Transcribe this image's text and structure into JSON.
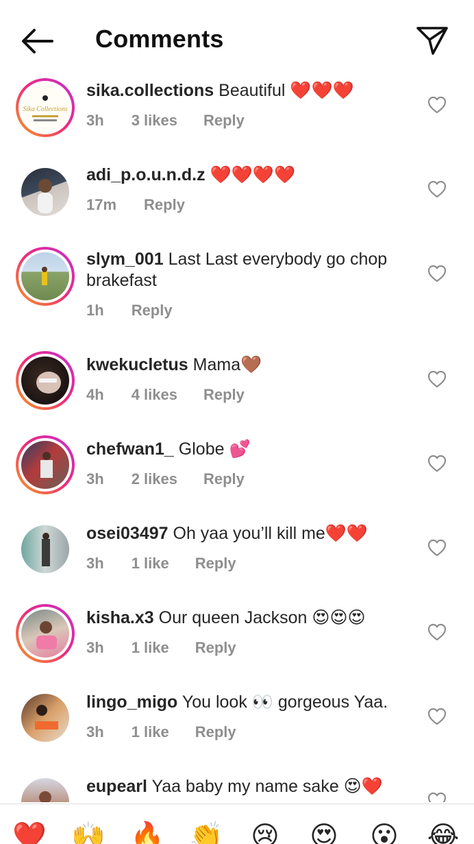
{
  "header": {
    "title": "Comments"
  },
  "comments": [
    {
      "username": "sika.collections",
      "text": "Beautiful ❤️❤️❤️",
      "time": "3h",
      "likes": "3 likes",
      "reply": "Reply"
    },
    {
      "username": "adi_p.o.u.n.d.z",
      "text": "❤️❤️❤️❤️",
      "time": "17m",
      "likes": "",
      "reply": "Reply"
    },
    {
      "username": "slym_001",
      "text": "Last Last everybody go chop brakefast",
      "time": "1h",
      "likes": "",
      "reply": "Reply"
    },
    {
      "username": "kwekucletus",
      "text": "Mama🤎",
      "time": "4h",
      "likes": "4 likes",
      "reply": "Reply"
    },
    {
      "username": "chefwan1_",
      "text": "Globe 💕",
      "time": "3h",
      "likes": "2 likes",
      "reply": "Reply"
    },
    {
      "username": "osei03497",
      "text": "Oh yaa you’ll kill me❤️❤️",
      "time": "3h",
      "likes": "1 like",
      "reply": "Reply"
    },
    {
      "username": "kisha.x3",
      "text": "Our queen Jackson 😍😍😍",
      "time": "3h",
      "likes": "1 like",
      "reply": "Reply"
    },
    {
      "username": "lingo_migo",
      "text": "You look 👀 gorgeous Yaa.",
      "time": "3h",
      "likes": "1 like",
      "reply": "Reply"
    },
    {
      "username": "eupearl",
      "text": "Yaa baby my name sake 😍❤️",
      "time": "",
      "likes": "",
      "reply": ""
    }
  ],
  "emoji_bar": [
    "❤️",
    "🙌",
    "🔥",
    "👏",
    "😢",
    "😍",
    "😮",
    "😂"
  ],
  "avatar_logo_text": "Sika Collections",
  "colors": {
    "accent_heart": "#e0245e",
    "meta_gray": "#8e8e8e",
    "ring_start": "#f9a01a",
    "ring_end": "#c42fd1"
  }
}
